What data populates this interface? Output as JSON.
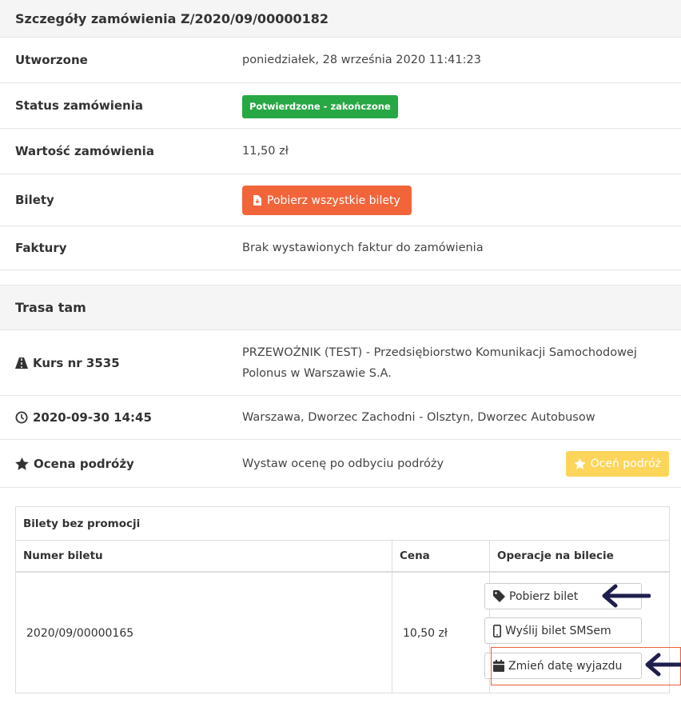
{
  "order": {
    "title": "Szczegóły zamówienia Z/2020/09/00000182",
    "rows": {
      "created_label": "Utworzone",
      "created_value": "poniedziałek, 28 września 2020 11:41:23",
      "status_label": "Status zamówienia",
      "status_value": "Potwierdzone - zakończone",
      "amount_label": "Wartość zamówienia",
      "amount_value": "11,50 zł",
      "tickets_label": "Bilety",
      "download_all_label": "Pobierz wszystkie bilety",
      "invoices_label": "Faktury",
      "invoices_value": "Brak wystawionych faktur do zamówienia"
    }
  },
  "route": {
    "title": "Trasa tam",
    "course_label": "Kurs nr 3535",
    "carrier_line1": "PRZEWOŹNIK (TEST) - Przedsiębiorstwo Komunikacji Samochodowej",
    "carrier_line2": "Polonus w Warszawie S.A.",
    "datetime_label": "2020-09-30 14:45",
    "route_value": "Warszawa, Dworzec Zachodni - Olsztyn, Dworzec Autobusow",
    "rating_label": "Ocena podróży",
    "rating_value": "Wystaw ocenę po odbyciu podróży",
    "rate_button": "Oceń podróż"
  },
  "ticket_table": {
    "caption": "Bilety bez promocji",
    "headers": [
      "Numer biletu",
      "Cena",
      "Operacje na bilecie"
    ],
    "row": {
      "number": "2020/09/00000165",
      "price": "10,50 zł",
      "ops": [
        "Pobierz bilet",
        "Wyślij bilet SMSem",
        "Zmień datę wyjazdu"
      ]
    }
  },
  "colors": {
    "status_green": "#28a745",
    "primary_orange": "#f2653a",
    "rate_yellow": "#fdd55a",
    "arrow_navy": "#1f1f4d",
    "highlight_red": "#e8603c"
  }
}
